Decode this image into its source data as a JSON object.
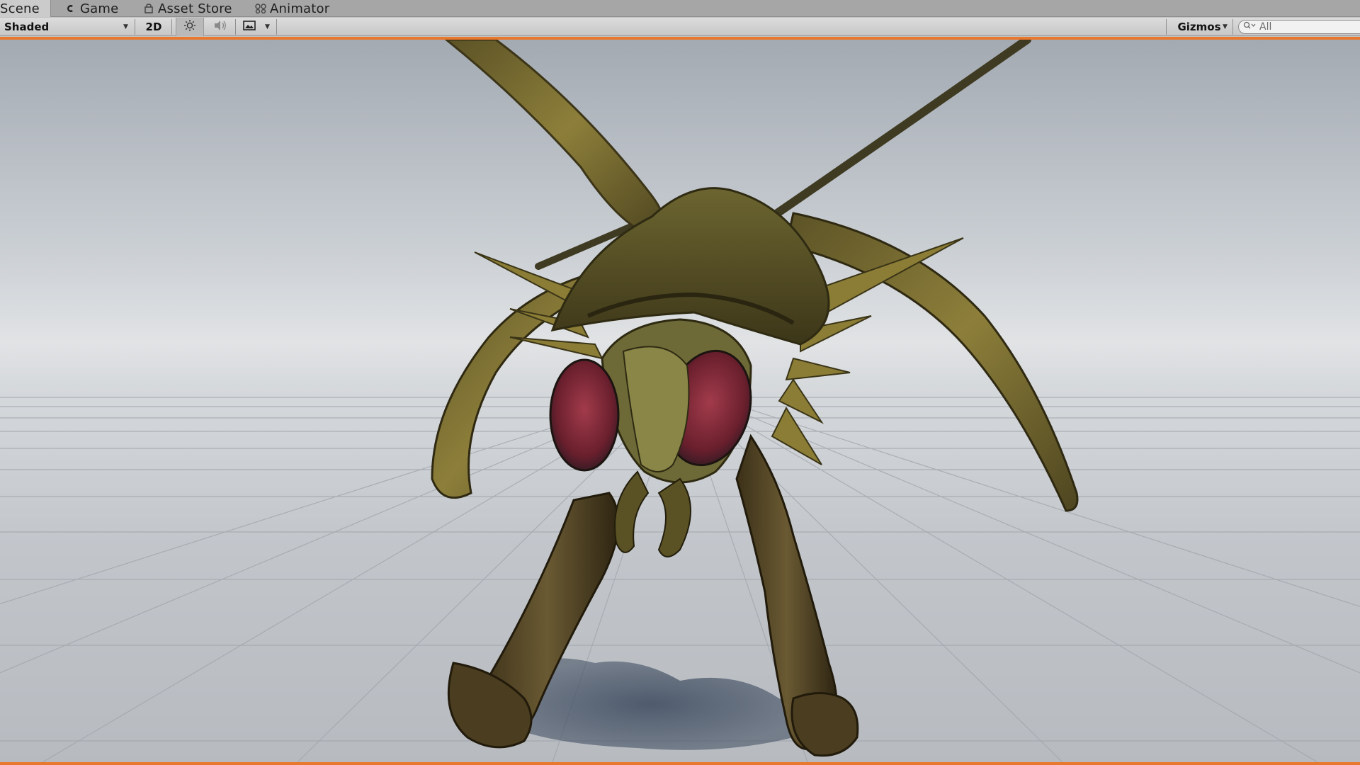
{
  "tabs": [
    {
      "label": "Scene",
      "icon": "scene-icon",
      "active": true
    },
    {
      "label": "Game",
      "icon": "game-icon",
      "active": false
    },
    {
      "label": "Asset Store",
      "icon": "asset-store-icon",
      "active": false
    },
    {
      "label": "Animator",
      "icon": "animator-icon",
      "active": false
    }
  ],
  "toolbar": {
    "shading_mode": "Shaded",
    "mode_2d_label": "2D",
    "lighting_icon": "sun-icon",
    "audio_icon": "speaker-icon",
    "effects_icon": "image-icon",
    "gizmos_label": "Gizmos",
    "search_placeholder": "All"
  },
  "colors": {
    "accent": "#e9782f",
    "tab_bar": "#a6a6a6",
    "toolbar": "#d2d2d2"
  }
}
